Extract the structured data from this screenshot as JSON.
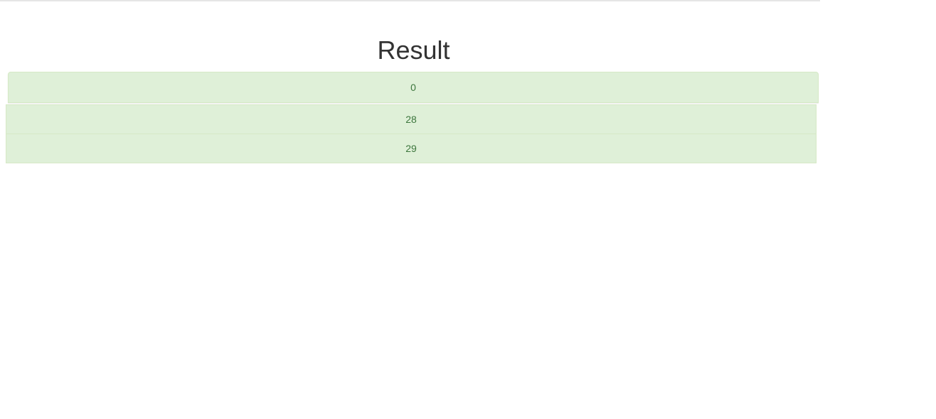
{
  "page": {
    "title": "Result"
  },
  "result_panel": {
    "value": "0"
  },
  "results": [
    {
      "value": "28"
    },
    {
      "value": "29"
    }
  ],
  "colors": {
    "row_background": "#dff0d8",
    "row_border": "#d6e9c6",
    "row_text": "#3c763d",
    "title_text": "#333333"
  }
}
